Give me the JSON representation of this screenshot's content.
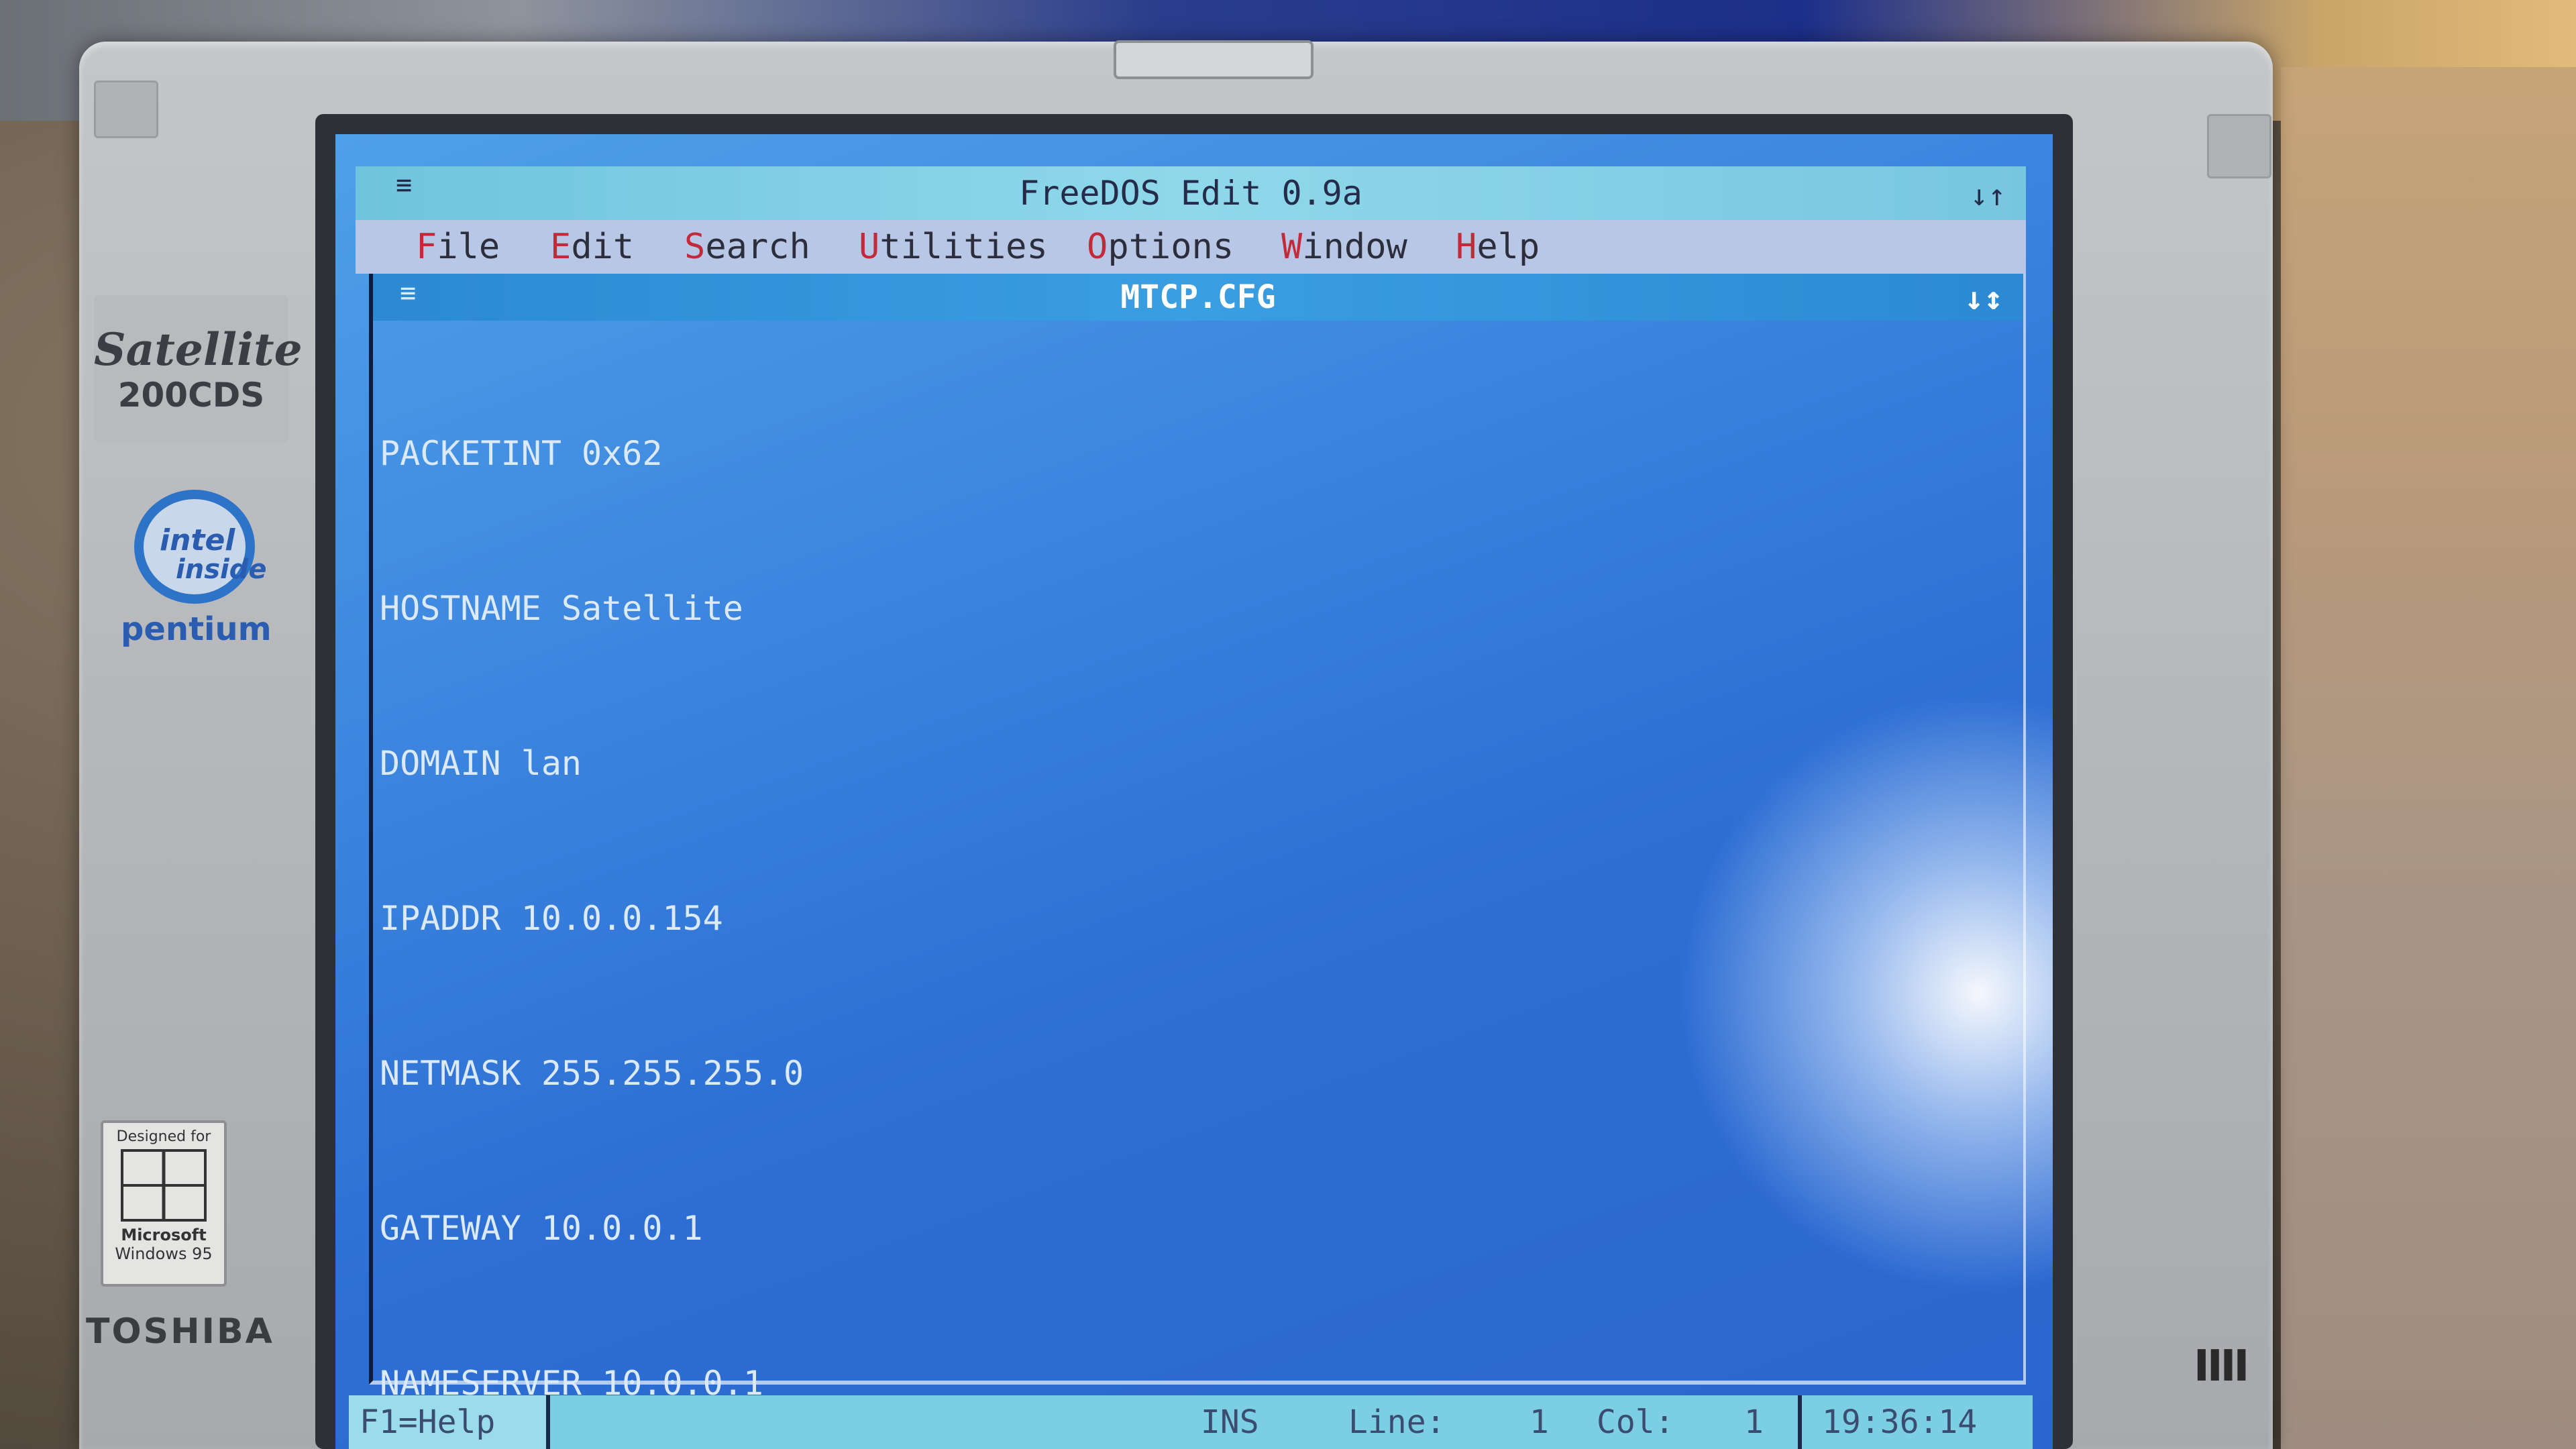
{
  "window": {
    "title": "FreeDOS Edit 0.9a",
    "system_menu_glyph": "≡",
    "resize_glyph": "↓↑"
  },
  "menu": {
    "items": [
      {
        "hot": "F",
        "rest": "ile"
      },
      {
        "hot": "E",
        "rest": "dit"
      },
      {
        "hot": "S",
        "rest": "earch"
      },
      {
        "hot": "U",
        "rest": "tilities"
      },
      {
        "hot": "O",
        "rest": "ptions"
      },
      {
        "hot": "W",
        "rest": "indow"
      },
      {
        "hot": "H",
        "rest": "elp"
      }
    ]
  },
  "document": {
    "filename": "MTCP.CFG",
    "system_menu_glyph": "≡",
    "resize_glyph": "↓↕",
    "lines": [
      "PACKETINT 0x62",
      "HOSTNAME Satellite",
      "DOMAIN lan",
      "IPADDR 10.0.0.154",
      "NETMASK 255.255.255.0",
      "GATEWAY 10.0.0.1",
      "NAMESERVER 10.0.0.1"
    ]
  },
  "status": {
    "help": "F1=Help",
    "mode": "INS",
    "line_label": "Line:",
    "line_value": "1",
    "col_label": "Col:",
    "col_value": "1",
    "clock": "19:36:14"
  },
  "hardware": {
    "satellite_brand": "Satellite",
    "satellite_model": "200CDS",
    "intel_line1": "intel",
    "intel_line2": "inside",
    "intel_cpu": "pentium",
    "win95_designed": "Designed for",
    "win95_microsoft": "Microsoft",
    "win95_windows": "Windows 95",
    "manufacturer": "TOSHIBA",
    "speaker_glyph": "IIII"
  }
}
